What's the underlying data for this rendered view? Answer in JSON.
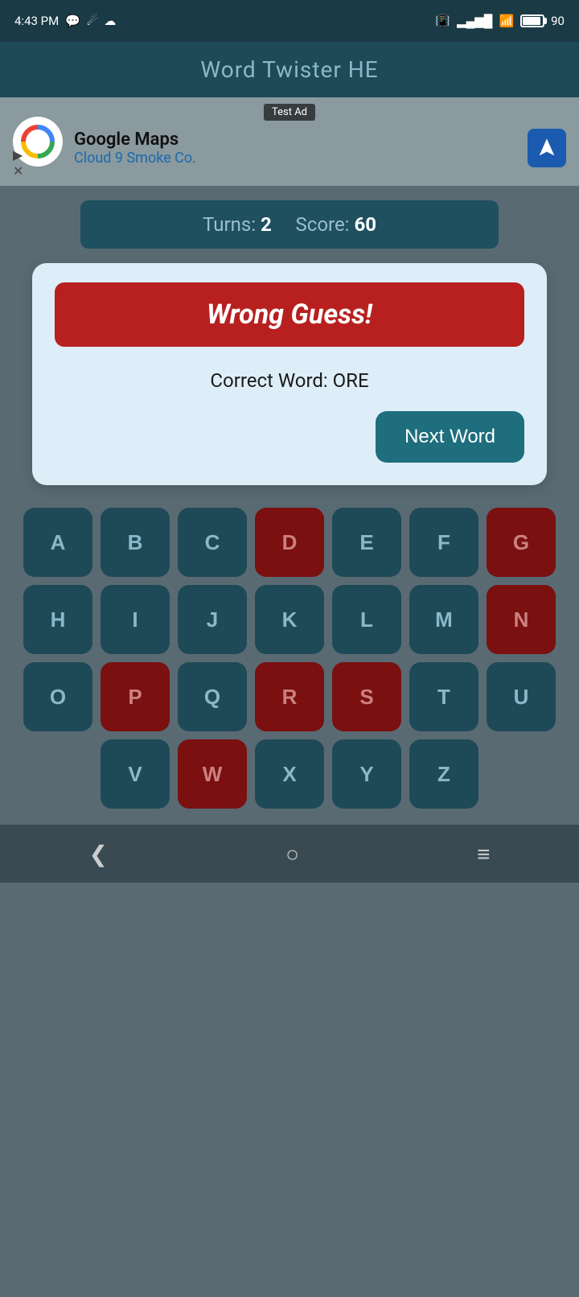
{
  "statusBar": {
    "time": "4:43 PM",
    "battery": "90"
  },
  "header": {
    "title": "Word Twister HE"
  },
  "ad": {
    "label": "Test Ad",
    "company": "Google Maps",
    "subtitle": "Cloud 9 Smoke Co."
  },
  "scoreBar": {
    "turnsLabel": "Turns:",
    "turns": "2",
    "scoreLabel": "Score:",
    "score": "60"
  },
  "resultCard": {
    "wrongGuessText": "Wrong Guess!",
    "correctWordLabel": "Correct Word: ORE",
    "nextWordBtn": "Next Word"
  },
  "keyboard": {
    "rows": [
      [
        {
          "letter": "A",
          "used": false
        },
        {
          "letter": "B",
          "used": false
        },
        {
          "letter": "C",
          "used": false
        },
        {
          "letter": "D",
          "used": true
        },
        {
          "letter": "E",
          "used": false
        },
        {
          "letter": "F",
          "used": false
        },
        {
          "letter": "G",
          "used": true
        }
      ],
      [
        {
          "letter": "H",
          "used": false
        },
        {
          "letter": "I",
          "used": false
        },
        {
          "letter": "J",
          "used": false
        },
        {
          "letter": "K",
          "used": false
        },
        {
          "letter": "L",
          "used": false
        },
        {
          "letter": "M",
          "used": false
        },
        {
          "letter": "N",
          "used": true
        }
      ],
      [
        {
          "letter": "O",
          "used": false
        },
        {
          "letter": "P",
          "used": true
        },
        {
          "letter": "Q",
          "used": false
        },
        {
          "letter": "R",
          "used": true
        },
        {
          "letter": "S",
          "used": true
        },
        {
          "letter": "T",
          "used": false
        },
        {
          "letter": "U",
          "used": false
        }
      ],
      [
        {
          "letter": "V",
          "used": false
        },
        {
          "letter": "W",
          "used": true
        },
        {
          "letter": "X",
          "used": false
        },
        {
          "letter": "Y",
          "used": false
        },
        {
          "letter": "Z",
          "used": false
        }
      ]
    ]
  }
}
